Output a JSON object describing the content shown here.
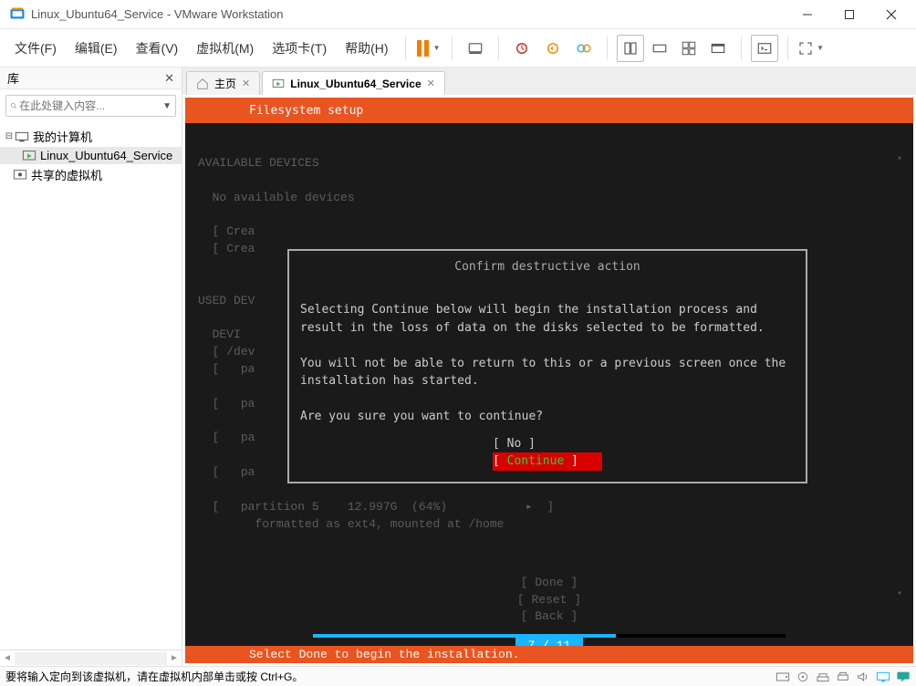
{
  "window": {
    "title": "Linux_Ubuntu64_Service - VMware Workstation"
  },
  "menu": {
    "file": "文件(F)",
    "edit": "编辑(E)",
    "view": "查看(V)",
    "vm": "虚拟机(M)",
    "tabs": "选项卡(T)",
    "help": "帮助(H)"
  },
  "library": {
    "title": "库",
    "search_placeholder": "在此处键入内容...",
    "tree": {
      "root": "我的计算机",
      "child1": "Linux_Ubuntu64_Service",
      "child2": "共享的虚拟机"
    }
  },
  "tabs": {
    "home": "主页",
    "vm": "Linux_Ubuntu64_Service"
  },
  "vm": {
    "header": "Filesystem setup",
    "devices_title": "AVAILABLE DEVICES",
    "no_devices": "No available devices",
    "crea1": "[ Crea",
    "crea2": "[ Crea",
    "used": "USED DEV",
    "devi": "DEVI",
    "dev": "[ /dev",
    "pa": "[   pa",
    "part5": "[   partition 5    12.997G  (64%)           ▸  ]",
    "part5_fmt": "      formatted as ext4, mounted at /home",
    "btn_done": "[ Done       ]",
    "btn_reset": "[ Reset      ]",
    "btn_back": "[ Back       ]",
    "progress_text": "7 / 11",
    "progress_pct": 64,
    "hint": "Select Done to begin the installation."
  },
  "dialog": {
    "title": "Confirm destructive action",
    "body1": "Selecting Continue below will begin the installation process and result in the loss of data on the disks selected to be formatted.",
    "body2": "You will not be able to return to this or a previous screen once the installation has started.",
    "body3": "Are you sure you want to continue?",
    "no_label": "No",
    "continue_label": "Continue"
  },
  "statusbar": {
    "text": "要将输入定向到该虚拟机，请在虚拟机内部单击或按 Ctrl+G。"
  }
}
